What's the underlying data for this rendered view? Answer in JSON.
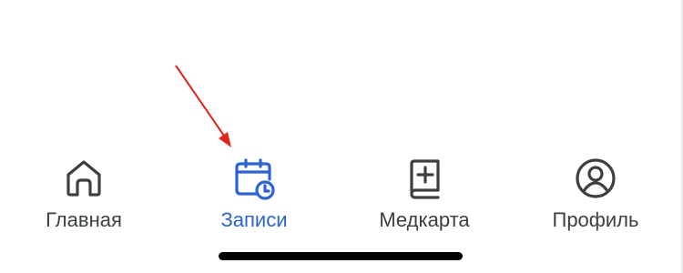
{
  "tabbar": {
    "active_tab": "Записи",
    "tabs": [
      {
        "label": "Главная",
        "icon": "home-icon"
      },
      {
        "label": "Записи",
        "icon": "calendar-clock-icon"
      },
      {
        "label": "Медкарта",
        "icon": "medical-book-icon"
      },
      {
        "label": "Профиль",
        "icon": "profile-icon"
      }
    ]
  },
  "colors": {
    "active": "#2b63d3",
    "inactive": "#3c4043",
    "annotation_arrow": "#e0231c",
    "home_indicator": "#000000"
  },
  "annotation": {
    "type": "arrow",
    "points_to": "Записи"
  }
}
